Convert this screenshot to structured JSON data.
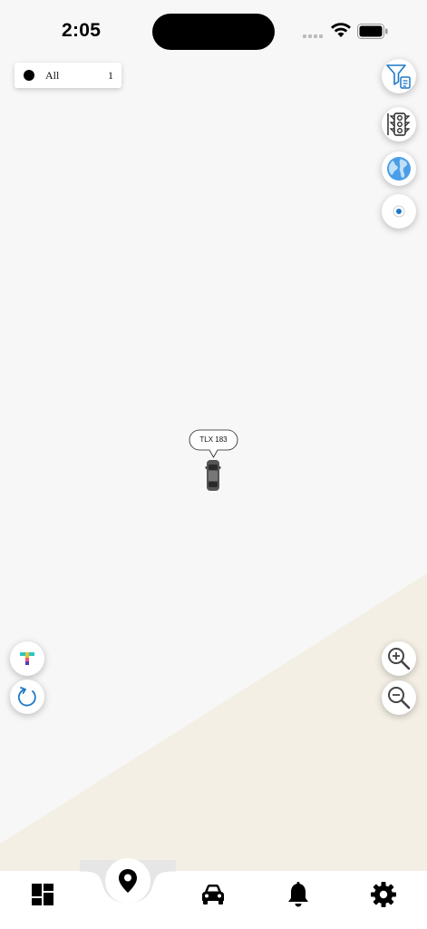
{
  "status": {
    "time": "2:05"
  },
  "filter": {
    "label": "All",
    "count": "1"
  },
  "map": {
    "vehicle_label": "TLX 183"
  },
  "icons": {
    "filter": "filter-list-icon",
    "traffic": "traffic-light-icon",
    "map_type": "globe-icon",
    "locate": "locate-me-icon",
    "app": "t-logo-icon",
    "refresh": "refresh-icon",
    "zoom_in": "zoom-in-icon",
    "zoom_out": "zoom-out-icon",
    "nav_dashboard": "dashboard-icon",
    "nav_map": "map-pin-icon",
    "nav_vehicles": "car-icon",
    "nav_alerts": "bell-icon",
    "nav_settings": "gear-icon"
  },
  "colors": {
    "map_bg": "#f7f7f7",
    "land": "#f3efe4",
    "accent_blue": "#1e78c8",
    "nav_active_bg": "#e6e6e6"
  }
}
